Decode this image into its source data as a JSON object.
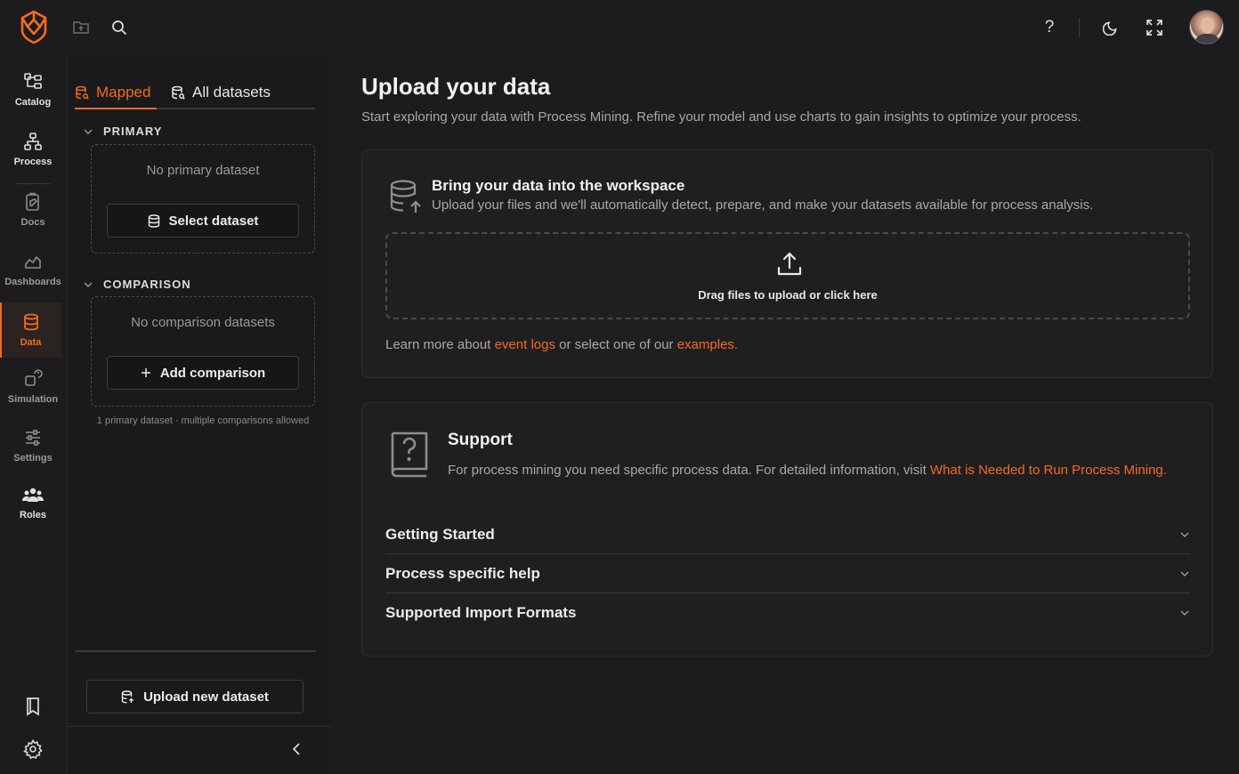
{
  "colors": {
    "accent": "#f26b21",
    "background": "#1c1c1e"
  },
  "topbar": {
    "icons": [
      "logo-icon",
      "folder-icon",
      "search-icon",
      "help-icon",
      "moon-icon",
      "expand-icon",
      "avatar"
    ],
    "help_glyph": "?"
  },
  "nav": {
    "items": [
      {
        "label": "Catalog",
        "icon": "catalog-icon"
      },
      {
        "label": "Process",
        "icon": "process-icon"
      },
      {
        "label": "Docs",
        "icon": "docs-icon"
      },
      {
        "label": "Dashboards",
        "icon": "dashboards-icon"
      },
      {
        "label": "Data",
        "icon": "data-icon",
        "active": true
      },
      {
        "label": "Simulation",
        "icon": "simulation-icon"
      },
      {
        "label": "Settings",
        "icon": "settings-sliders-icon"
      },
      {
        "label": "Roles",
        "icon": "roles-icon"
      }
    ]
  },
  "panel": {
    "tabs": {
      "mapped": "Mapped",
      "all": "All datasets"
    },
    "primary": {
      "heading": "PRIMARY",
      "empty": "No primary dataset",
      "button": "Select dataset"
    },
    "comparison": {
      "heading": "COMPARISON",
      "empty": "No comparison datasets",
      "button": "Add comparison"
    },
    "hint": "1 primary dataset · multiple comparisons allowed",
    "upload_button": "Upload new dataset"
  },
  "main": {
    "title": "Upload your data",
    "subtitle": "Start exploring your data with Process Mining. Refine your model and use charts to gain insights to optimize your process.",
    "bring": {
      "title": "Bring your data into the workspace",
      "subtitle": "Upload your files and we'll automatically detect, prepare, and make your datasets available for process analysis.",
      "drop_text": "Drag files to upload or click here",
      "learn_prefix": "Learn more about ",
      "learn_link1": "event logs",
      "learn_middle": " or select one of our ",
      "learn_link2": "examples",
      "learn_suffix": "."
    },
    "support": {
      "title": "Support",
      "text_prefix": "For process mining you need specific process data. For detailed information, visit ",
      "text_link": "What is Needed to Run Process Mining",
      "text_suffix": ".",
      "accordions": [
        "Getting Started",
        "Process specific help",
        "Supported Import Formats"
      ]
    }
  }
}
